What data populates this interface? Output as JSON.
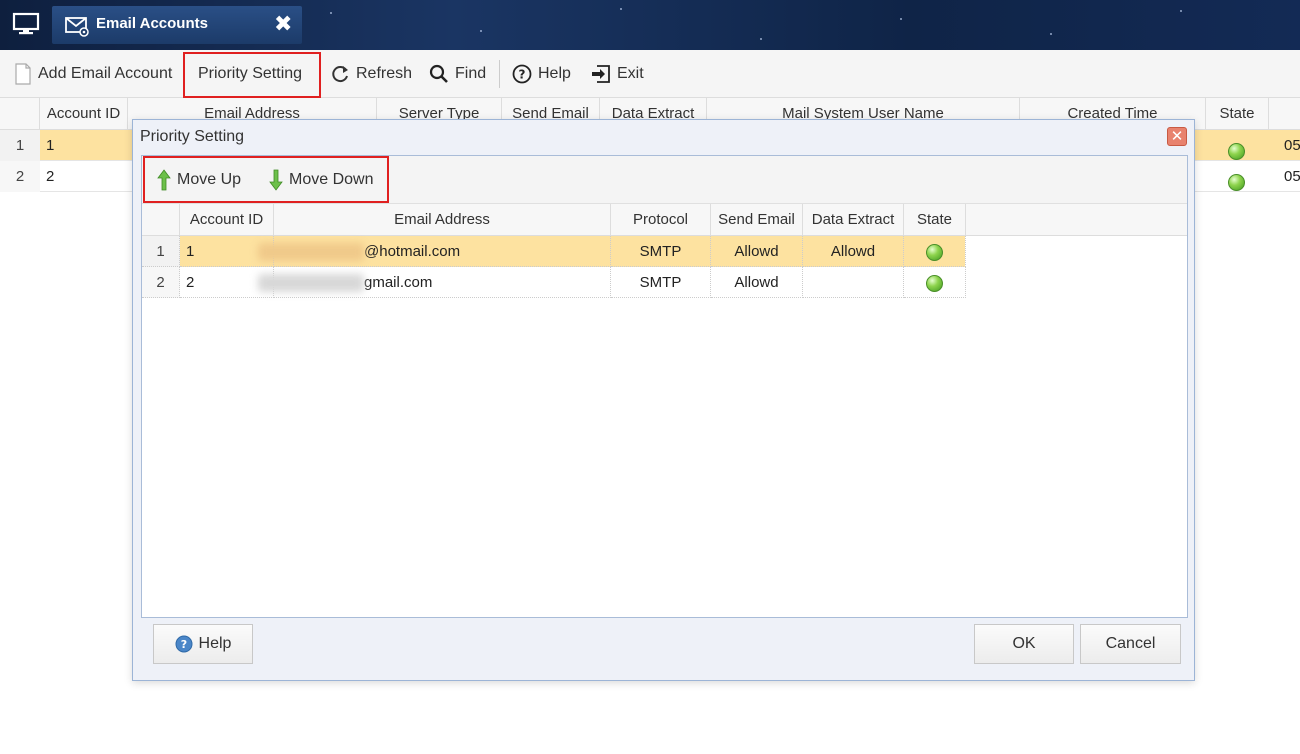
{
  "tab": {
    "title": "Email Accounts",
    "close_glyph": "✖"
  },
  "toolbar": {
    "add_label": "Add Email Account",
    "priority_label": "Priority Setting",
    "refresh_label": "Refresh",
    "find_label": "Find",
    "help_label": "Help",
    "exit_label": "Exit"
  },
  "main_grid": {
    "headers": [
      "Account ID",
      "Email Address",
      "Server Type",
      "Send Email",
      "Data Extract",
      "Mail System User Name",
      "Created Time",
      "State"
    ],
    "rows": [
      {
        "num": "1",
        "id": "1",
        "created": "05"
      },
      {
        "num": "2",
        "id": "2",
        "created": "05"
      }
    ]
  },
  "dialog": {
    "title": "Priority Setting",
    "close_glyph": "✕",
    "move_up_label": "Move Up",
    "move_down_label": "Move Down",
    "headers": [
      "Account ID",
      "Email Address",
      "Protocol",
      "Send Email",
      "Data Extract",
      "State"
    ],
    "rows": [
      {
        "num": "1",
        "id": "1",
        "email_visible": "@hotmail.com",
        "protocol": "SMTP",
        "send": "Allowd",
        "extract": "Allowd"
      },
      {
        "num": "2",
        "id": "2",
        "email_visible": "gmail.com",
        "protocol": "SMTP",
        "send": "Allowd",
        "extract": ""
      }
    ],
    "help_label": "Help",
    "ok_label": "OK",
    "cancel_label": "Cancel"
  },
  "colors": {
    "selected_row": "#fde2a0",
    "highlight_box": "#e02020",
    "dialog_border": "#9cb4d6"
  }
}
